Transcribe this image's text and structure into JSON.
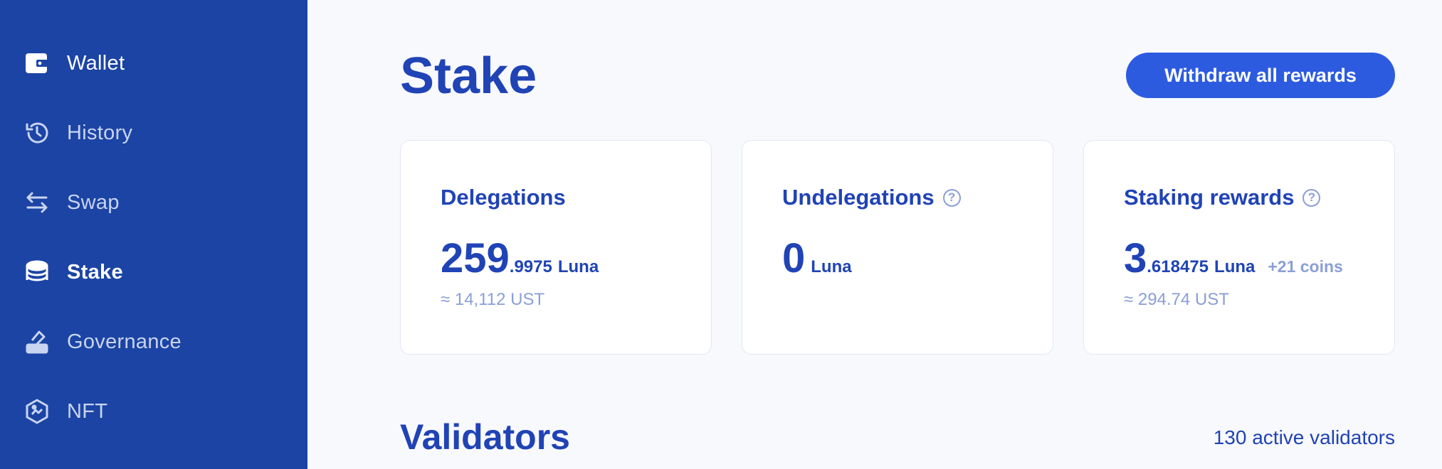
{
  "sidebar": {
    "items": [
      {
        "label": "Wallet",
        "icon": "wallet-icon"
      },
      {
        "label": "History",
        "icon": "history-icon"
      },
      {
        "label": "Swap",
        "icon": "swap-icon"
      },
      {
        "label": "Stake",
        "icon": "stake-icon"
      },
      {
        "label": "Governance",
        "icon": "governance-icon"
      },
      {
        "label": "NFT",
        "icon": "nft-icon"
      }
    ],
    "active": "Stake"
  },
  "header": {
    "title": "Stake",
    "withdraw_label": "Withdraw all rewards"
  },
  "cards": {
    "delegations": {
      "title": "Delegations",
      "int": "259",
      "dec": ".9975",
      "unit": "Luna",
      "approx": "≈ 14,112 UST"
    },
    "undelegations": {
      "title": "Undelegations",
      "help": "?",
      "int": "0",
      "unit": "Luna"
    },
    "rewards": {
      "title": "Staking rewards",
      "help": "?",
      "int": "3",
      "dec": ".618475",
      "unit": "Luna",
      "extra": "+21 coins",
      "approx": "≈ 294.74 UST"
    }
  },
  "validators": {
    "title": "Validators",
    "count_text": "130 active validators"
  },
  "colors": {
    "sidebar_bg": "#1b44a4",
    "accent": "#2c5be0",
    "text_primary": "#2043b5",
    "text_muted": "#8b9fd6"
  }
}
